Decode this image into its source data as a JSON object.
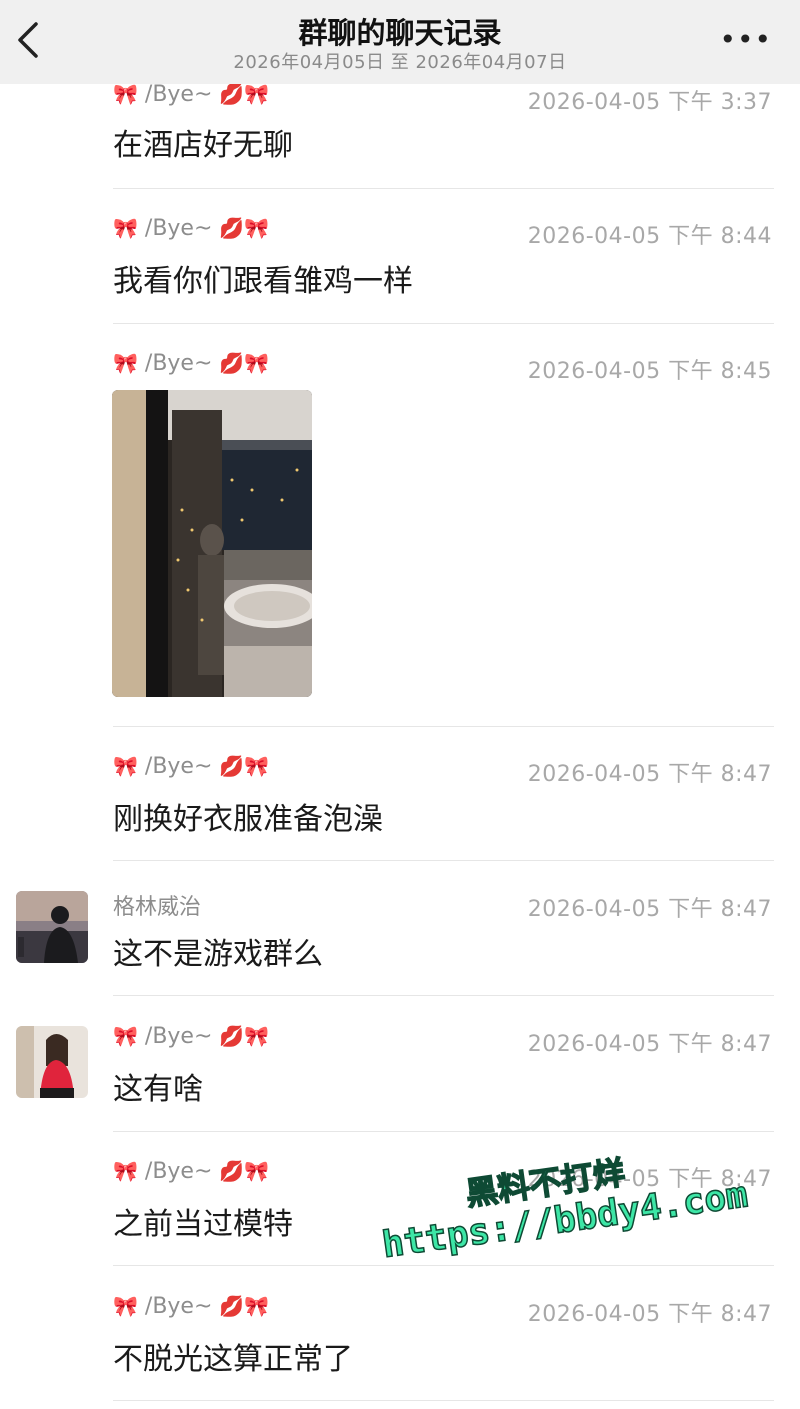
{
  "header": {
    "title": "群聊的聊天记录",
    "subtitle": "2026年04月05日 至 2026年04月07日",
    "back_icon": "chevron-left-icon",
    "more_label": "•••"
  },
  "colors": {
    "header_bg": "#f0f0f0",
    "sender": "#8d8d8d",
    "time": "#a8a8a8",
    "watermark": "#3de6a6"
  },
  "messages": [
    {
      "sender": "/Bye~",
      "time": "2026-04-05 下午 3:37",
      "text": "在酒店好无聊"
    },
    {
      "sender": "/Bye~",
      "time": "2026-04-05 下午 8:44",
      "text": "我看你们跟看雏鸡一样"
    },
    {
      "sender": "/Bye~",
      "time": "2026-04-05 下午 8:45",
      "text": ""
    },
    {
      "sender": "/Bye~",
      "time": "2026-04-05 下午 8:47",
      "text": "刚换好衣服准备泡澡"
    },
    {
      "sender": "格林威治",
      "time": "2026-04-05 下午 8:47",
      "text": "这不是游戏群么"
    },
    {
      "sender": "/Bye~",
      "time": "2026-04-05 下午 8:47",
      "text": "这有啥"
    },
    {
      "sender": "/Bye~",
      "time": "2026-04-05 下午 8:47",
      "text": "之前当过模特"
    },
    {
      "sender": "/Bye~",
      "time": "2026-04-05 下午 8:47",
      "text": "不脱光这算正常了"
    }
  ],
  "decor": {
    "bow": "🎀",
    "lips": "💋"
  },
  "watermark": {
    "line1": "黑料不打烊",
    "line2": "https://bbdy4.com"
  }
}
